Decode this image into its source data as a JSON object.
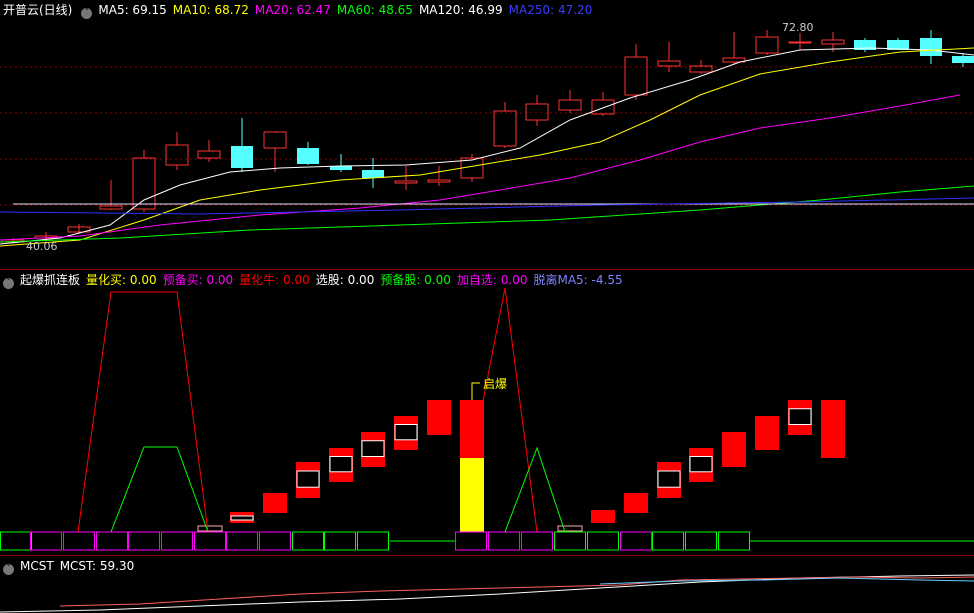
{
  "main": {
    "title": "开普云(日线)",
    "ma": [
      {
        "label": "MA5: 69.15",
        "color": "#ffffff"
      },
      {
        "label": "MA10: 68.72",
        "color": "#ffff00"
      },
      {
        "label": "MA20: 62.47",
        "color": "#ff00ff"
      },
      {
        "label": "MA60: 48.65",
        "color": "#00ff00"
      },
      {
        "label": "MA120: 46.99",
        "color": "#ffffff"
      },
      {
        "label": "MA250: 47.20",
        "color": "#0000ff"
      }
    ],
    "high_label": "72.80",
    "low_label": "40.06"
  },
  "indicator": {
    "title": "起爆抓连板",
    "items": [
      {
        "label": "量化买: 0.00",
        "color": "#ffff00"
      },
      {
        "label": "预备买: 0.00",
        "color": "#ff00ff"
      },
      {
        "label": "量化牛: 0.00",
        "color": "#ff0000"
      },
      {
        "label": "选股: 0.00",
        "color": "#ffffff"
      },
      {
        "label": "预备股: 0.00",
        "color": "#00ff00"
      },
      {
        "label": "加自选: 0.00",
        "color": "#ff00ff"
      },
      {
        "label": "脱离MA5: -4.55",
        "color": "#8080ff"
      }
    ],
    "annotation": "启爆"
  },
  "mcst": {
    "title": "MCST",
    "value": "MCST: 59.30"
  },
  "colors": {
    "up": "#ff3232",
    "down": "#54ffff",
    "grid": "#8b0000"
  }
}
